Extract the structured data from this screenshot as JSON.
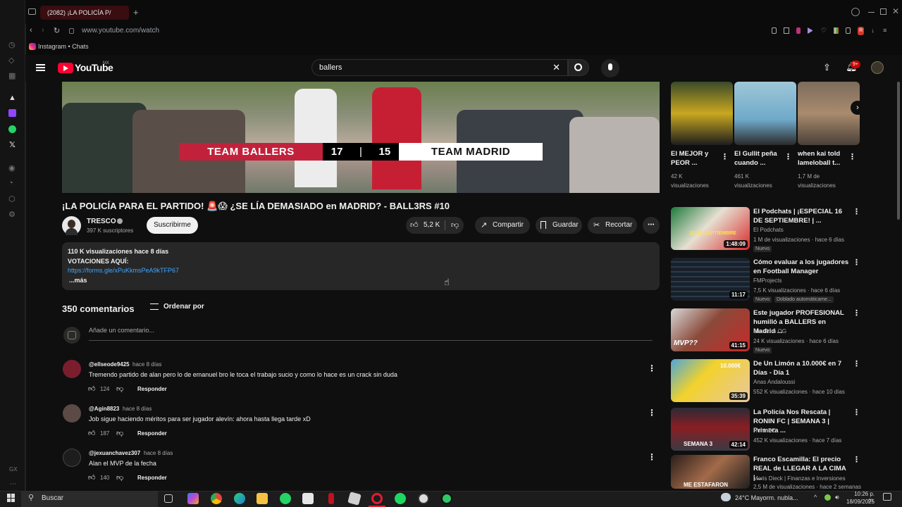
{
  "browser": {
    "tab_title": "(2082) ¡LA POLICÍA P/",
    "url": "www.youtube.com/watch",
    "bookmark": "Instagram • Chats"
  },
  "header": {
    "logo_text": "YouTube",
    "region": "MX",
    "search_value": "ballers",
    "notifications": "9+"
  },
  "video": {
    "team_left": "TEAM BALLERS",
    "score_left": "17",
    "score_sep": "|",
    "score_right": "15",
    "team_right": "TEAM MADRID",
    "title": "¡LA POLICÍA PARA EL PARTIDO! 🚨😱 ¿SE LÍA DEMASIADO en MADRID? - BALL3RS #10",
    "channel": "TRESCO",
    "subscribers": "397 K suscriptores",
    "subscribe_label": "Suscribirme",
    "likes": "5,2 K",
    "share_label": "Compartir",
    "save_label": "Guardar",
    "clip_label": "Recortar"
  },
  "description": {
    "stats": "110 K visualizaciones  hace 8 días",
    "line": "VOTACIONES AQUÍ:",
    "link": "https://forms.gle/xPuKkmsPeA9kTFP67",
    "more": "...más"
  },
  "comments": {
    "count": "350 comentarios",
    "sort_label": "Ordenar por",
    "placeholder": "Añade un comentario...",
    "reply_label": "Responder",
    "items": [
      {
        "user": "@ellseode9425",
        "time": "hace 8 días",
        "text": "Tremendo partido de alan pero lo de emanuel bro le toca el trabajo sucio y como lo hace es un crack sin duda",
        "likes": "124"
      },
      {
        "user": "@Agin8823",
        "time": "hace 8 días",
        "text": "Job sigue haciendo méritos para ser jugador alevín: ahora hasta llega tarde xD",
        "likes": "187"
      },
      {
        "user": "@jexuanchavez307",
        "time": "hace 8 días",
        "text": "Alan el MVP de la fecha",
        "likes": "140"
      }
    ]
  },
  "shorts": [
    {
      "title": "El MEJOR y PEOR ...",
      "views": "42 K visualizaciones"
    },
    {
      "title": "El Gullit peña cuando ...",
      "views": "461 K visualizaciones"
    },
    {
      "title": "when kai told lameloball t...",
      "views": "1,7 M de visualizaciones"
    }
  ],
  "recommendations": [
    {
      "title": "El Podchats | ¡ESPECIAL 16 DE SEPTIEMBRE! | ...",
      "channel": "El Podchats",
      "meta": "1 M de visualizaciones · hace 6 días",
      "badge": "Nuevo",
      "duration": "1:48:09"
    },
    {
      "title": "Cómo evaluar a los jugadores en Football Manager",
      "channel": "FMProjects",
      "meta": "7,5 K visualizaciones · hace 6 días",
      "badge": "Nuevo",
      "badge2": "Doblado automáticame...",
      "duration": "11:17"
    },
    {
      "title": "Este jugador PROFESIONAL humilló a BALLERS en Madrid ...",
      "channel": "Iam Kuro OG",
      "meta": "24 K visualizaciones · hace 6 días",
      "badge": "Nuevo",
      "duration": "41:15"
    },
    {
      "title": "De Un Limón a 10.000€ en 7 Días - Día 1",
      "channel": "Anas Andaloussi",
      "meta": "552 K visualizaciones · hace 10 días",
      "duration": "35:39"
    },
    {
      "title": "La Policía Nos Rescata | RONIN FC | SEMANA 3 | Primera ...",
      "channel": "RoninFC",
      "meta": "452 K visualizaciones · hace 7 días",
      "duration": "42:14"
    },
    {
      "title": "Franco Escamilla: El precio REAL de LLEGAR A LA CIMA | ...",
      "channel": "Moris Dieck | Finanzas e Inversiones",
      "meta": "2,5 M de visualizaciones · hace 2 semanas",
      "duration": ""
    }
  ],
  "thumb_text": {
    "r1": "16 DE SEPTIEMBRE",
    "r3": "MVP??",
    "r4": "10.000€",
    "r5": "SEMANA 3",
    "r6": "ME ESTAFARON"
  },
  "taskbar": {
    "search": "Buscar",
    "weather": "24°C  Mayorm. nubla...",
    "time": "10:26 p. m.",
    "date": "18/09/2025"
  }
}
